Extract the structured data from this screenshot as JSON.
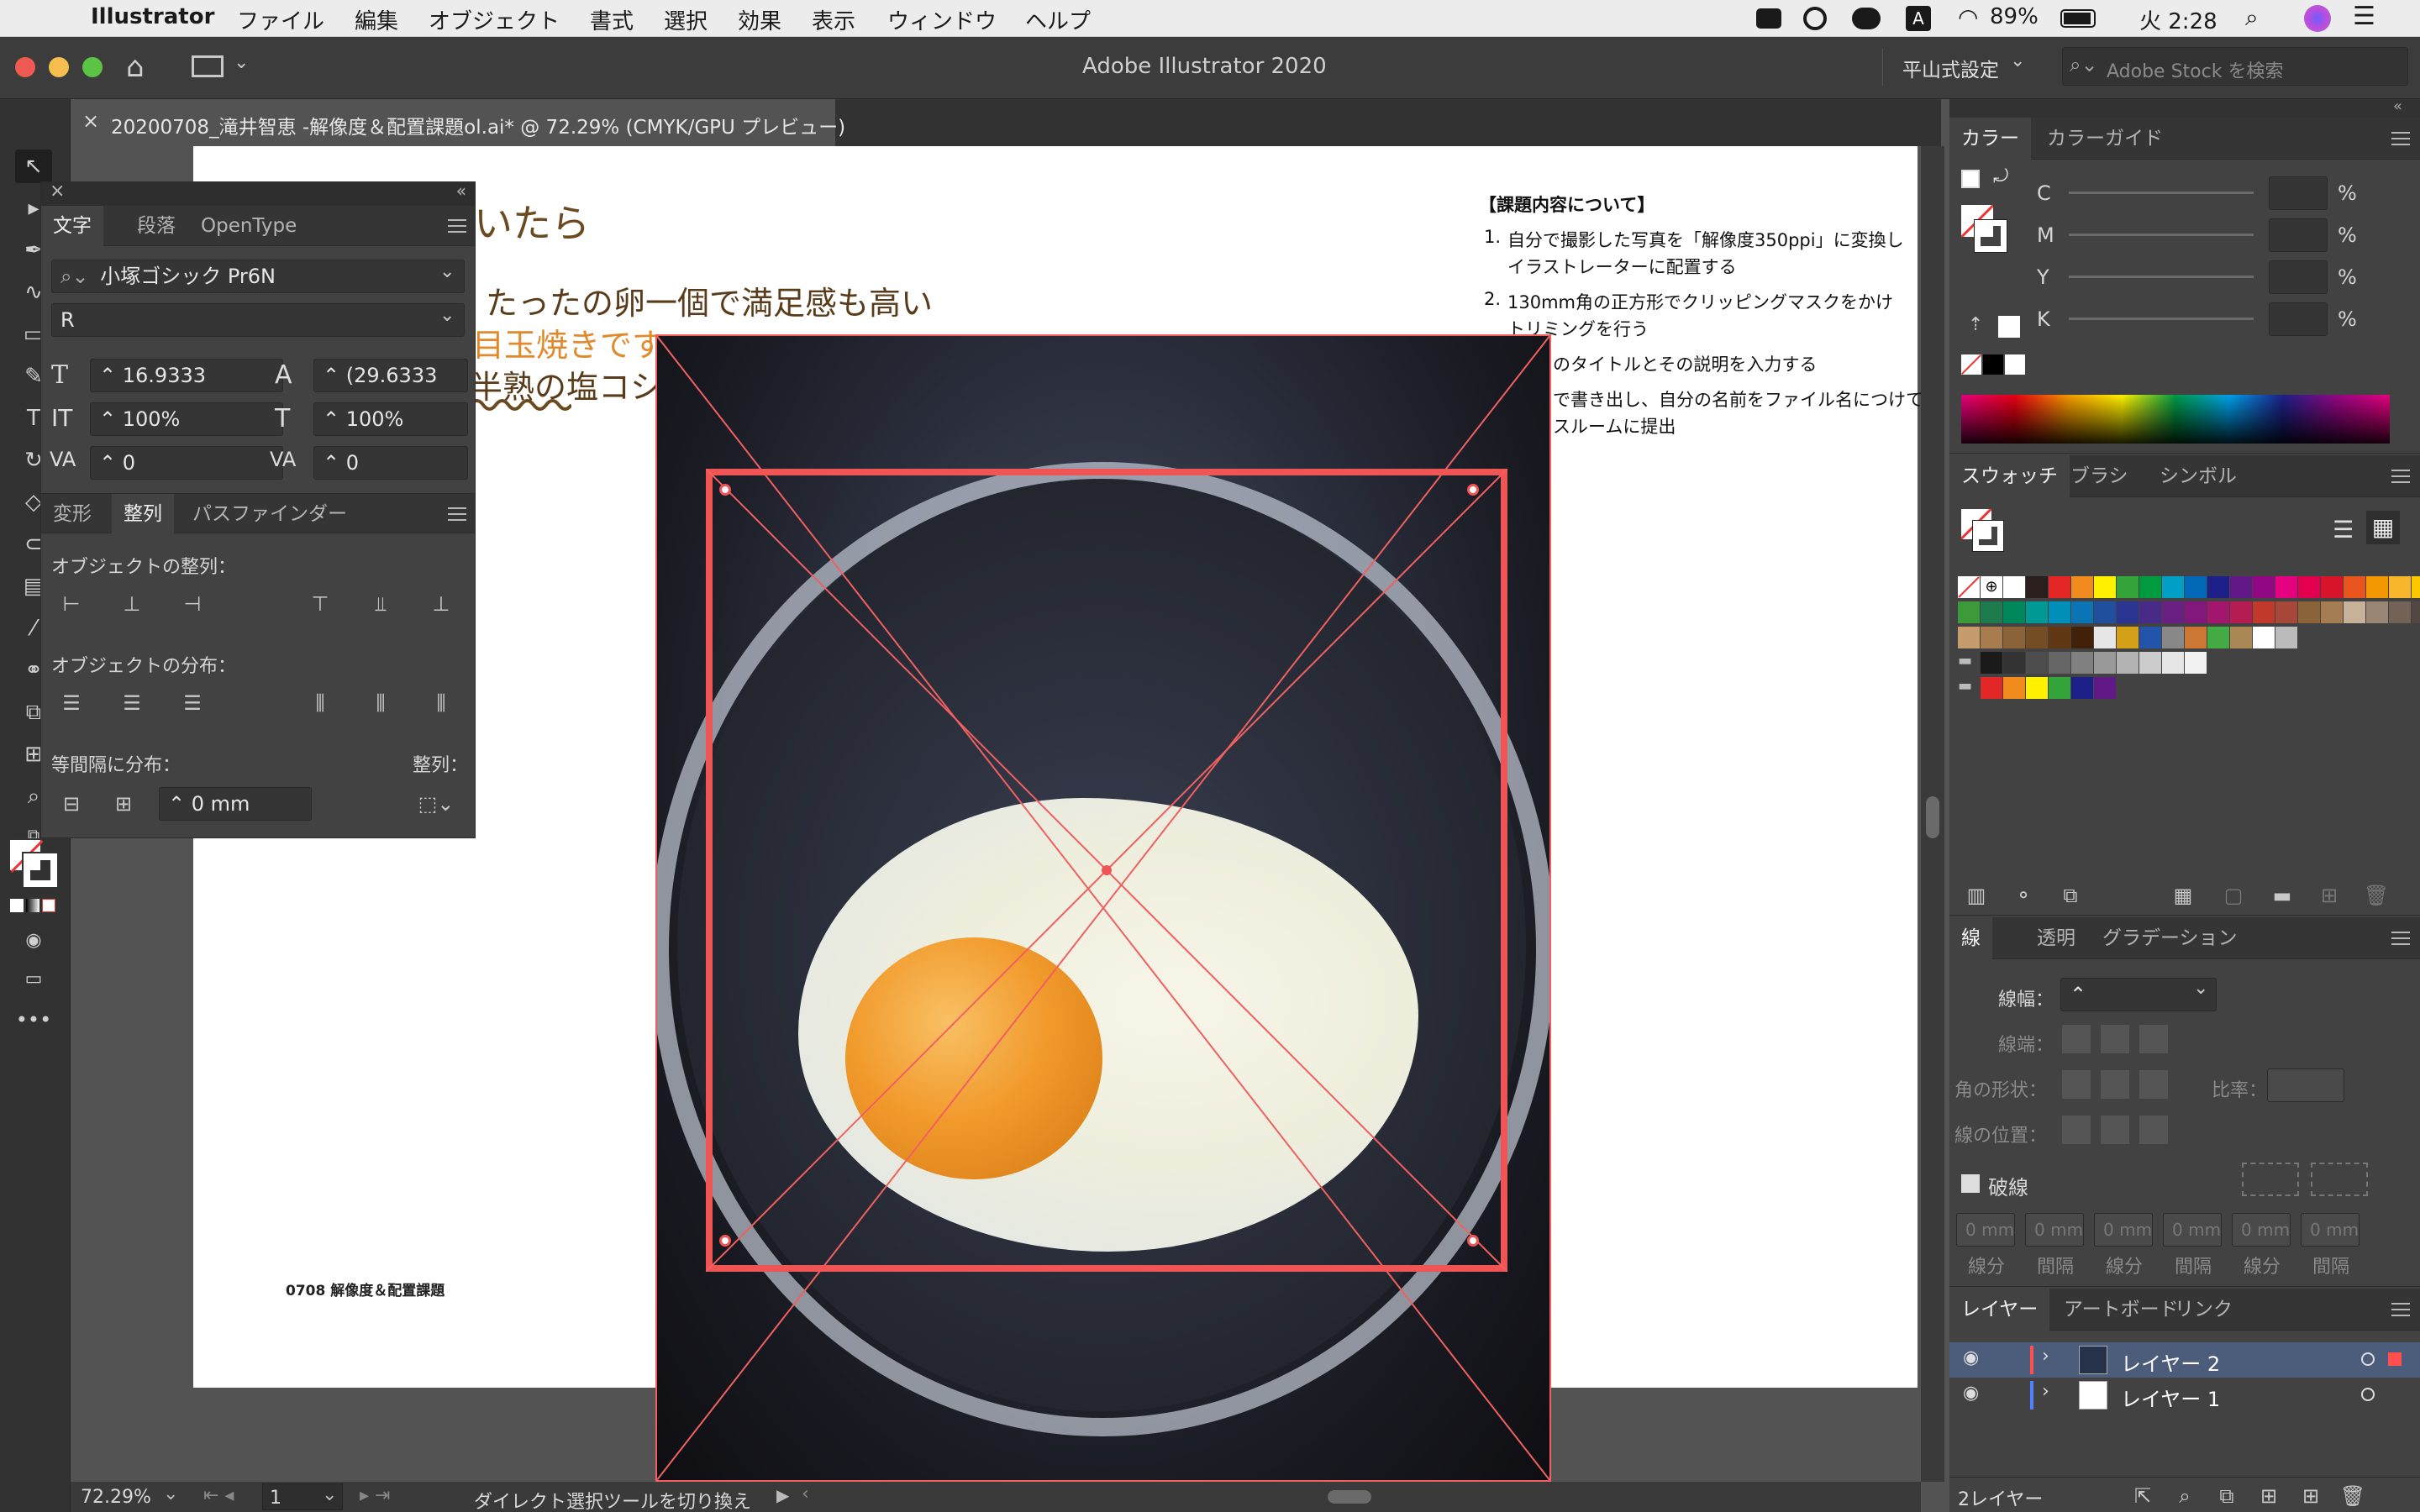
{
  "menubar": {
    "apple": "",
    "app_name": "Illustrator",
    "items": [
      "ファイル",
      "編集",
      "オブジェクト",
      "書式",
      "選択",
      "効果",
      "表示",
      "ウィンドウ",
      "ヘルプ"
    ],
    "battery": "89%",
    "time": "火 2:28"
  },
  "window": {
    "title": "Adobe Illustrator 2020",
    "workspace": "平山式設定",
    "search_placeholder": "Adobe Stock を検索"
  },
  "document_tab": {
    "close": "×",
    "label": "20200708_滝井智恵 -解像度＆配置課題ol.ai* @ 72.29% (CMYK/GPU プレビュー)"
  },
  "artboard": {
    "heading": "いたら",
    "line1": "たったの卵一個で満足感も高い",
    "line2": "目玉焼きです",
    "line3": "半熟の塩コシ",
    "footer": "0708  解像度＆配置課題",
    "brief": {
      "title": "【課題内容について】",
      "items": [
        {
          "n": "1.",
          "text": "自分で撮影した写真を「解像度350ppi」に変換し",
          "cont": "イラストレーターに配置する"
        },
        {
          "n": "2.",
          "text": "130mm角の正方形でクリッピングマスクをかけ",
          "cont": "トリミングを行う"
        },
        {
          "n": "",
          "text": "のタイトルとその説明を入力する",
          "cont": ""
        },
        {
          "n": "",
          "text": "で書き出し、自分の名前をファイル名につけて",
          "cont": "スルームに提出"
        }
      ]
    }
  },
  "character_panel": {
    "tabs": [
      "文字",
      "段落",
      "OpenType"
    ],
    "font_family": "小塚ゴシック Pr6N",
    "font_style": "R",
    "font_size": "16.9333",
    "leading": "(29.6333",
    "vscale": "100%",
    "hscale": "100%",
    "kerning": "0",
    "tracking": "0"
  },
  "align_panel": {
    "tabs": [
      "変形",
      "整列",
      "パスファインダー"
    ],
    "align_objects": "オブジェクトの整列：",
    "distribute_objects": "オブジェクトの分布：",
    "distribute_spacing": "等間隔に分布：",
    "align_to": "整列：",
    "spacing_value": "0 mm"
  },
  "color_panel": {
    "tabs": [
      "カラー",
      "カラーガイド"
    ],
    "channels": [
      "C",
      "M",
      "Y",
      "K"
    ],
    "percent": "%"
  },
  "swatches_panel": {
    "tabs": [
      "スウォッチ",
      "ブラシ",
      "シンボル"
    ],
    "row1": [
      "#ffffff",
      "#2b1f1d",
      "#e32726",
      "#f18b1e",
      "#fff100",
      "#35a43a",
      "#009b3e",
      "#00a0c6",
      "#0068b7",
      "#1d2088",
      "#601986",
      "#920783",
      "#e4007f",
      "#e5004f",
      "#d7142a",
      "#e8541c",
      "#f39800",
      "#f8b62d",
      "#fcc800",
      "#d7df01",
      "#8fc31f"
    ],
    "row2": [
      "#3d9a3a",
      "#1e7b4e",
      "#00885a",
      "#009994",
      "#008fb8",
      "#0a74b5",
      "#1f4f9d",
      "#2a3592",
      "#482a87",
      "#6a1f82",
      "#82187b",
      "#a3166d",
      "#b41c52",
      "#c0392b",
      "#a6473a",
      "#8c6239",
      "#a67c52",
      "#c7b299",
      "#998675",
      "#736357",
      "#534741"
    ],
    "row3": [
      "#c69c6d",
      "#a97c50",
      "#8c6239",
      "#754c24",
      "#603813",
      "#42210b",
      "#e6e6e6",
      "#d4a017",
      "#2255aa",
      "#888888",
      "#cc7733",
      "#44aa44",
      "#aa8855",
      "#ffffff",
      "#bbbbbb"
    ],
    "row4": [
      "#1a1a1a",
      "#333333",
      "#4d4d4d",
      "#666666",
      "#808080",
      "#999999",
      "#b3b3b3",
      "#cccccc",
      "#e6e6e6",
      "#f2f2f2"
    ],
    "row5": [
      "#e32726",
      "#f18b1e",
      "#fff100",
      "#35a43a",
      "#1d2088",
      "#601986"
    ]
  },
  "stroke_panel": {
    "tabs": [
      "線",
      "透明",
      "グラデーション"
    ],
    "weight": "線幅：",
    "cap": "線端：",
    "corner": "角の形状：",
    "limit": "比率：",
    "align": "線の位置：",
    "dashed": "破線",
    "dash_values": [
      "0 mm",
      "0 mm",
      "0 mm",
      "0 mm",
      "0 mm",
      "0 mm"
    ],
    "dash_labels": [
      "線分",
      "間隔",
      "線分",
      "間隔",
      "線分",
      "間隔"
    ]
  },
  "layers_panel": {
    "tabs": [
      "レイヤー",
      "アートボード",
      "リンク"
    ],
    "layers": [
      {
        "name": "レイヤー 2",
        "color": "#ff4f4f",
        "selected": true
      },
      {
        "name": "レイヤー 1",
        "color": "#4f80ff",
        "selected": false
      }
    ],
    "count": "2レイヤー"
  },
  "statusbar": {
    "zoom": "72.29%",
    "artboard_num": "1",
    "tool_hint": "ダイレクト選択ツールを切り換え"
  }
}
